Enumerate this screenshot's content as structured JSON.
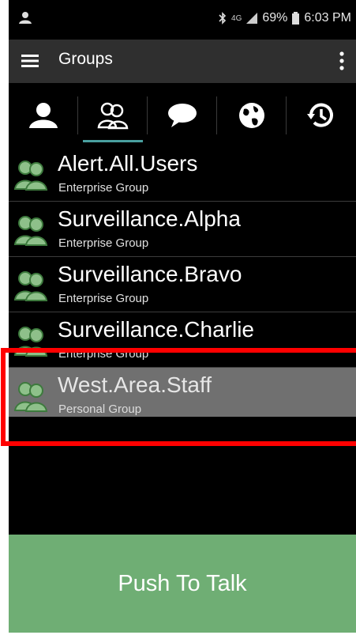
{
  "status_bar": {
    "battery": "69%",
    "time": "6:03 PM",
    "network": "4G"
  },
  "app_bar": {
    "title": "Groups"
  },
  "tabs": [
    {
      "icon": "contact-icon",
      "selected": false
    },
    {
      "icon": "groups-icon",
      "selected": true
    },
    {
      "icon": "chat-icon",
      "selected": false
    },
    {
      "icon": "globe-icon",
      "selected": false
    },
    {
      "icon": "history-icon",
      "selected": false
    }
  ],
  "groups": [
    {
      "name": "Alert.All.Users",
      "type": "Enterprise Group",
      "selected": false
    },
    {
      "name": "Surveillance.Alpha",
      "type": "Enterprise Group",
      "selected": false
    },
    {
      "name": "Surveillance.Bravo",
      "type": "Enterprise Group",
      "selected": false
    },
    {
      "name": "Surveillance.Charlie",
      "type": "Enterprise Group",
      "selected": false
    },
    {
      "name": "West.Area.Staff",
      "type": "Personal Group",
      "selected": true
    }
  ],
  "ptt_button": {
    "label": "Push To Talk"
  },
  "colors": {
    "accent": "#4aa0a0",
    "ptt": "#6fae74",
    "highlight": "#ff0000"
  }
}
